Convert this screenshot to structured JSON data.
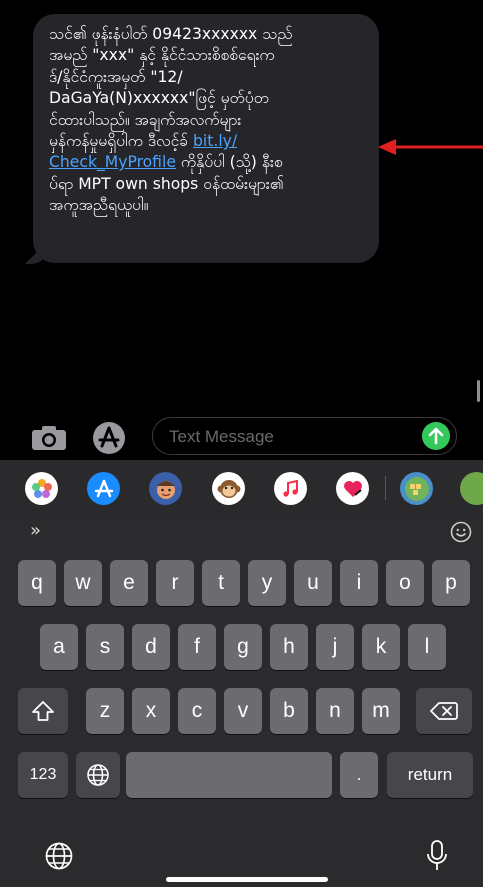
{
  "message": {
    "lines": [
      "သင်၏ ဖုန်းနံပါတ် 09423xxxxxx သည်",
      "အမည် \"xxx\" နှင့် နိုင်ငံသားစိစစ်ရေးက",
      "ဒ်/နိုင်ငံကူးအမှတ် \"12/",
      "DaGaYa(N)xxxxxx\"ဖြင့် မှတ်ပုံတ",
      "င်ထားပါသည်။ အချက်အလက်များ",
      "မှန်ကန်မှုမရှိပါက ဒီလင့်ခ် "
    ],
    "link_part1": "bit.ly/",
    "link_part2": "Check_MyProfile",
    "after_link": " ကိုနှိပ်ပါ (သို့) နီးစ",
    "lines_end": [
      "ပ်ရာ MPT own shops ဝန်ထမ်းများ၏",
      "အကူအညီရယူပါ။"
    ]
  },
  "input": {
    "placeholder": "Text Message"
  },
  "apps_strip": {
    "icons": [
      "photos-icon",
      "app-store-icon",
      "memoji-icon",
      "animoji-monkey-icon",
      "music-icon",
      "digital-touch-icon",
      "game-icon",
      "game-icon-2"
    ]
  },
  "keyboard": {
    "row1": [
      "q",
      "w",
      "e",
      "r",
      "t",
      "y",
      "u",
      "i",
      "o",
      "p"
    ],
    "row2": [
      "a",
      "s",
      "d",
      "f",
      "g",
      "h",
      "j",
      "k",
      "l"
    ],
    "row3": [
      "z",
      "x",
      "c",
      "v",
      "b",
      "n",
      "m"
    ],
    "numbers_key": "123",
    "period_key": ".",
    "return_key": "return",
    "chevron": "»"
  },
  "colors": {
    "bubble": "#26252a",
    "link": "#4aa3ff",
    "send": "#34c759",
    "arrow": "#e0201e",
    "key": "#6c6c70",
    "key_dark": "#47474b"
  }
}
